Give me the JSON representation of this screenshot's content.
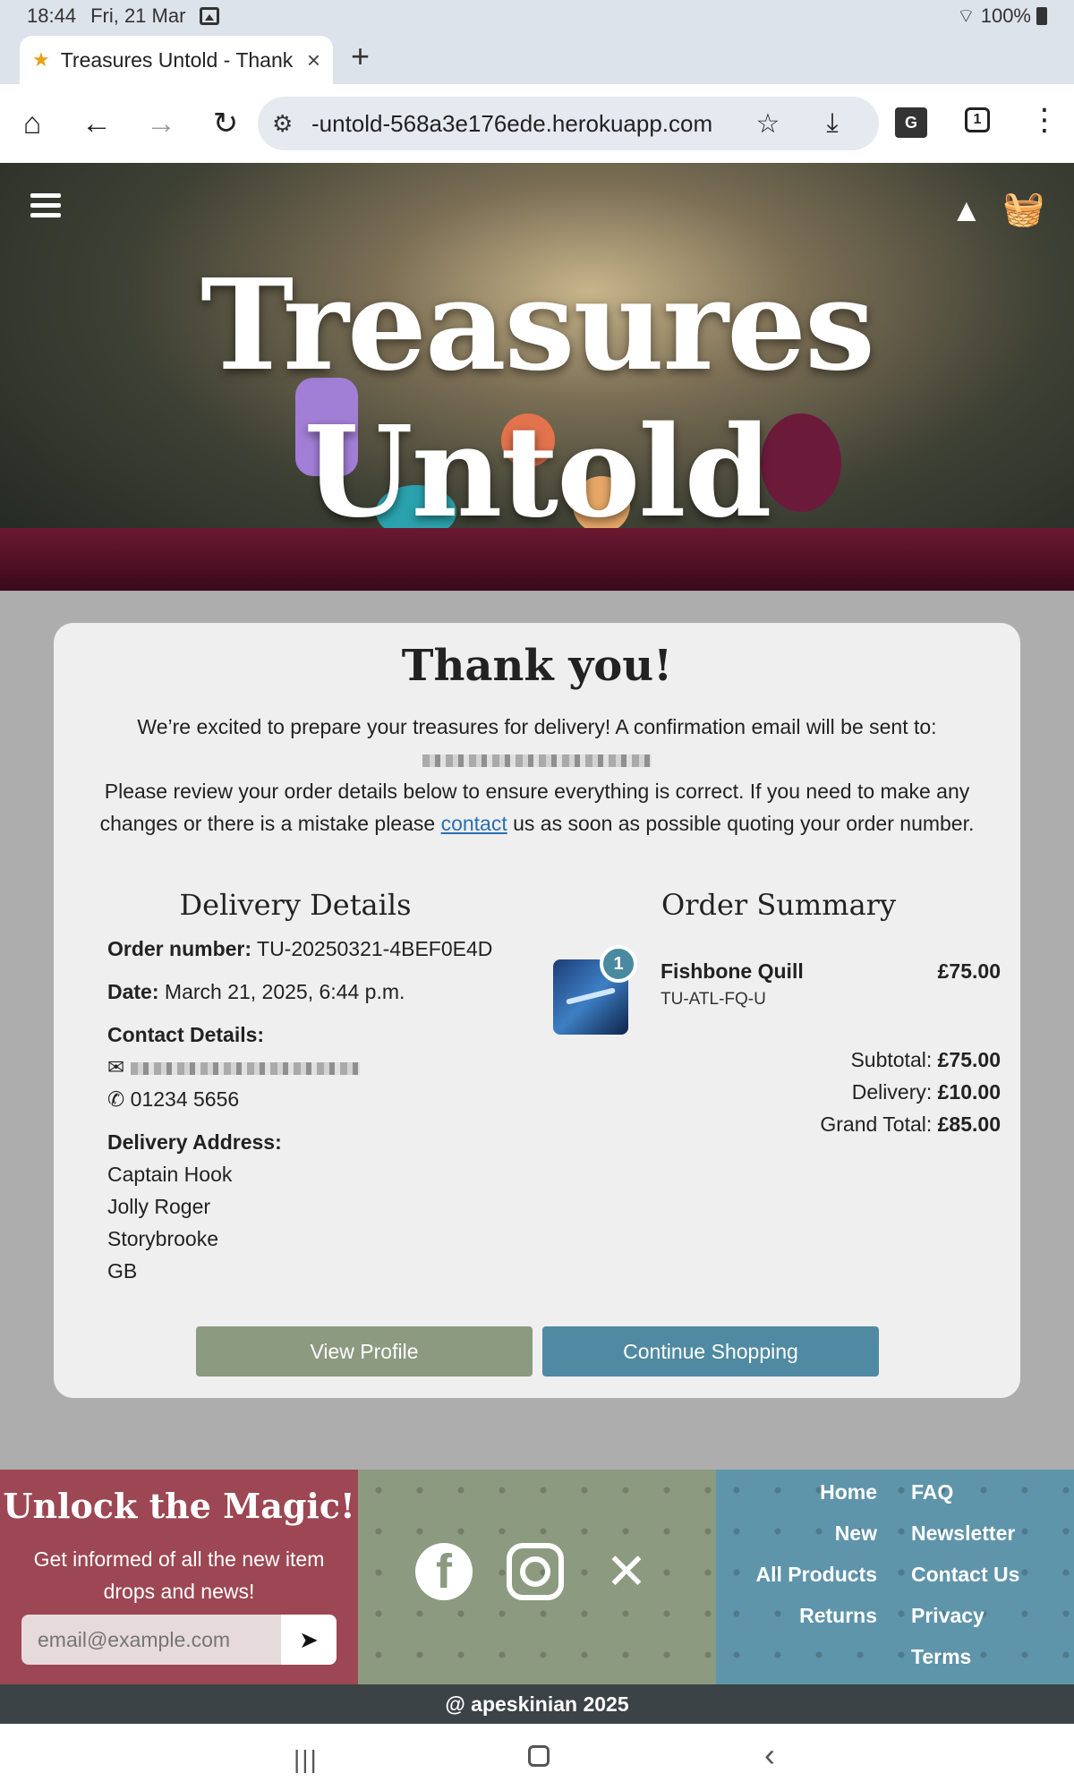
{
  "status_bar": {
    "time": "18:44",
    "date": "Fri, 21 Mar",
    "battery": "100%"
  },
  "browser": {
    "tab_title": "Treasures Untold - Thank",
    "url": "-untold-568a3e176ede.herokuapp.com",
    "tab_count": "1",
    "translate_label": "G"
  },
  "hero": {
    "brand": "Treasures Untold"
  },
  "confirmation": {
    "heading": "Thank you!",
    "intro_line1": "We’re excited to prepare your treasures for delivery! A confirmation email will be sent to:",
    "intro_line2_pre": "Please review your order details below to ensure everything is correct. If you need to make any changes or there is a mistake please ",
    "contact_link": "contact",
    "intro_line2_post": " us as soon as possible quoting your order number."
  },
  "delivery": {
    "heading": "Delivery Details",
    "order_number_label": "Order number:",
    "order_number": "TU-20250321-4BEF0E4D",
    "date_label": "Date:",
    "date": "March 21, 2025, 6:44 p.m.",
    "contact_label": "Contact Details:",
    "phone": "01234 5656",
    "address_label": "Delivery Address:",
    "address": [
      "Captain Hook",
      "Jolly Roger",
      "Storybrooke",
      "GB"
    ]
  },
  "summary": {
    "heading": "Order Summary",
    "item": {
      "name": "Fishbone Quill",
      "sku": "TU-ATL-FQ-U",
      "price": "£75.00",
      "quantity": "1"
    },
    "subtotal_label": "Subtotal:",
    "subtotal": "£75.00",
    "delivery_label": "Delivery:",
    "delivery": "£10.00",
    "grand_total_label": "Grand Total:",
    "grand_total": "£85.00"
  },
  "actions": {
    "view_profile": "View Profile",
    "continue_shopping": "Continue Shopping"
  },
  "footer": {
    "newsletter_title": "Unlock the Magic!",
    "newsletter_text": "Get informed of all the new item drops and news!",
    "email_placeholder": "email@example.com",
    "links_left": [
      "Home",
      "New",
      "All Products",
      "Returns"
    ],
    "links_right": [
      "FAQ",
      "Newsletter",
      "Contact Us",
      "Privacy",
      "Terms"
    ],
    "copyright": "@ apeskinian 2025"
  },
  "colors": {
    "newsletter_bg": "#9c4753",
    "social_bg": "#8c9a80",
    "links_bg": "#5f95aa",
    "profile_button": "#8c9a80",
    "shop_button": "#4f8aa2"
  }
}
